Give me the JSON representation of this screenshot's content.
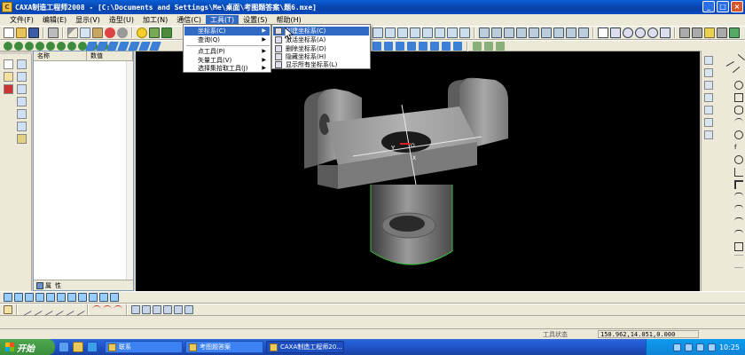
{
  "window": {
    "title": "CAXA制造工程师2008  - [C:\\Documents and Settings\\Me\\桌面\\考图题答案\\题6.mxe]",
    "app_icon_text": "C",
    "buttons": {
      "minimize": "_",
      "maximize": "□",
      "close": "×"
    }
  },
  "menubar": {
    "items": [
      {
        "label": "文件(F)"
      },
      {
        "label": "编辑(E)"
      },
      {
        "label": "显示(V)"
      },
      {
        "label": "造型(U)"
      },
      {
        "label": "加工(N)"
      },
      {
        "label": "通信(C)"
      },
      {
        "label": "工具(T)"
      },
      {
        "label": "设置(S)"
      },
      {
        "label": "帮助(H)"
      }
    ]
  },
  "tools_menu": {
    "items": [
      {
        "label": "坐标系(C)",
        "arrow": "▶"
      },
      {
        "label": "查询(Q)",
        "arrow": "▶"
      },
      {
        "label": "点工具(P)",
        "arrow": "▶"
      },
      {
        "label": "矢量工具(V)",
        "arrow": "▶"
      },
      {
        "label": "选择集拾取工具(J)",
        "arrow": "▶"
      }
    ]
  },
  "coord_submenu": {
    "items": [
      {
        "label": "创建坐标系(C)"
      },
      {
        "label": "激活坐标系(A)"
      },
      {
        "label": "删除坐标系(D)"
      },
      {
        "label": "隐藏坐标系(H)"
      },
      {
        "label": "显示所有坐标系(L)"
      }
    ]
  },
  "toolbar": {
    "combo_text": ""
  },
  "panel": {
    "col_name": "名称",
    "col_value": "数值",
    "tab_attr": "属",
    "tab_prop": "性"
  },
  "viewport": {
    "axis_x": "X",
    "axis_y": "Y",
    "origin_label": "O"
  },
  "status": {
    "label": "工具状态",
    "coords": "150.962,14.051,0.000"
  },
  "taskbar": {
    "start_label": "开始",
    "tasks": [
      {
        "label": "联系"
      },
      {
        "label": "考图题答案"
      },
      {
        "label": "CAXA制造工程师20..."
      }
    ],
    "clock": "10:25"
  },
  "colors": {
    "titlebar": "#0841a8",
    "menu_highlight": "#316ac5",
    "viewport_bg": "#000000",
    "taskbar": "#245edb",
    "start_button": "#3c8f3c"
  }
}
